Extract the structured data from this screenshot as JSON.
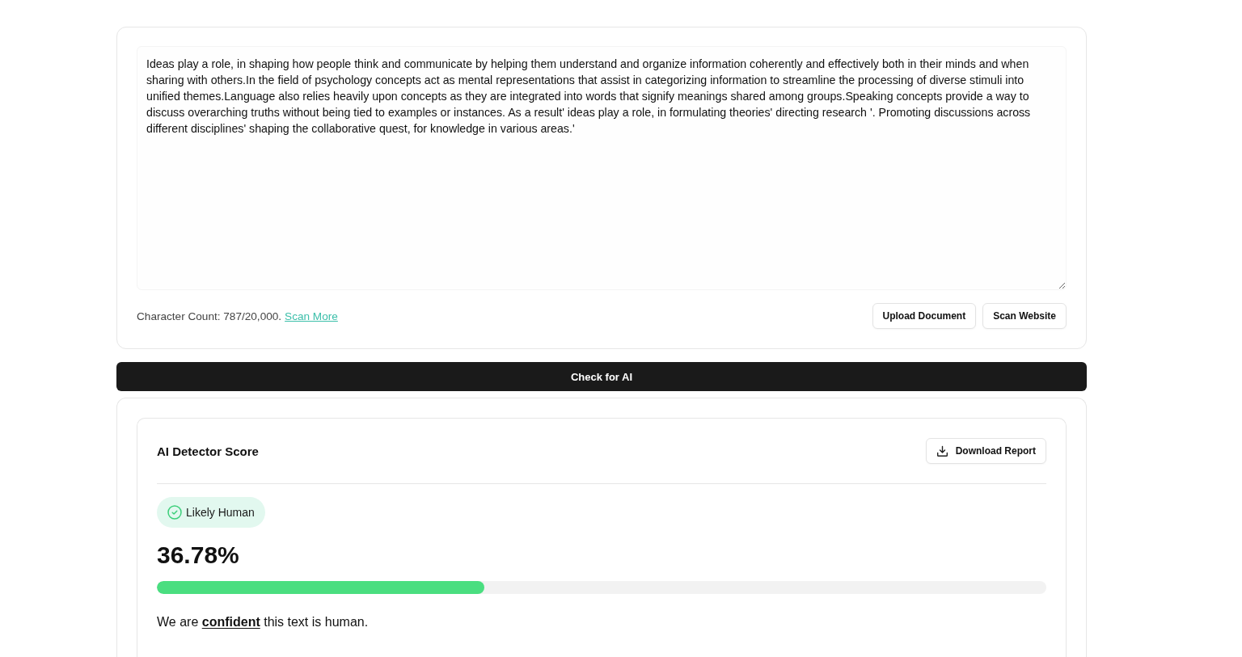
{
  "editor": {
    "value": "Ideas play a role, in shaping how people think and communicate by helping them understand and organize information coherently and effectively both in their minds and when sharing with others.In the field of psychology concepts act as mental representations that assist in categorizing information to streamline the processing of diverse stimuli into unified themes.Language also relies heavily upon concepts as they are integrated into words that signify meanings shared among groups.Speaking concepts provide a way to discuss overarching truths without being tied to examples or instances. As a result' ideas play a role, in formulating theories' directing research '. Promoting discussions across different disciplines' shaping the collaborative quest, for knowledge in various areas.'",
    "character_count": "Character Count: 787/20,000.",
    "scan_more_link": "Scan More",
    "buttons": [
      "Upload Document",
      "Scan Website"
    ]
  },
  "check_button": "Check for AI",
  "result": {
    "title": "AI Detector Score",
    "download_button": "Download Report",
    "verdict": "Likely Human",
    "score": "36.78%",
    "level": 0.3678,
    "summary": "We are **confident** this text is human."
  }
}
